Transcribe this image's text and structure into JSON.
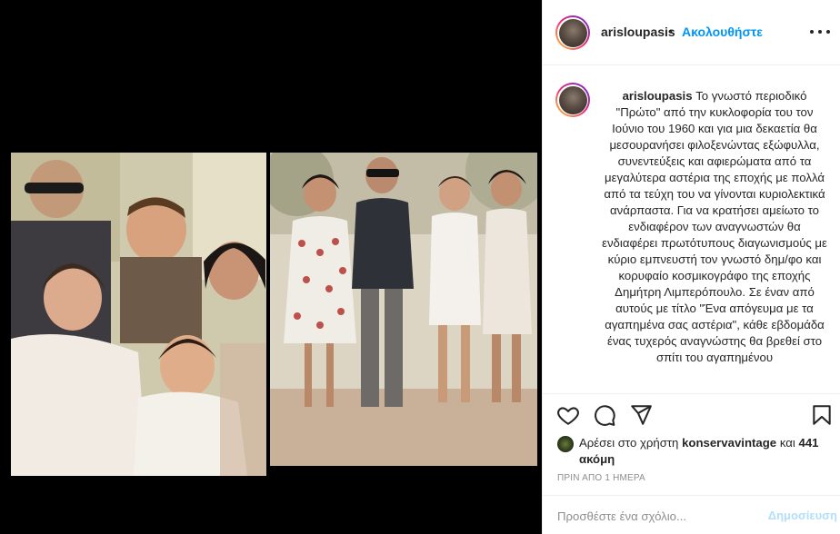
{
  "post": {
    "media": {
      "photos": [
        "vintage-family-photo",
        "vintage-garden-group-photo"
      ]
    },
    "header": {
      "username": "arisloupasis",
      "separator": "•",
      "follow_label": "Ακολουθήστε"
    },
    "caption": {
      "username": "arisloupasis",
      "text": "Το γνωστό περιοδικό \"Πρώτο\" από την κυκλοφορία του τον Ιούνιο του 1960 και για μια δεκαετία θα μεσουρανήσει φιλοξενώντας εξώφυλλα, συνεντεύξεις και αφιερώματα από τα μεγαλύτερα αστέρια της εποχής με πολλά από τα τεύχη του να γίνονται κυριολεκτικά ανάρπαστα. Για να κρατήσει αμείωτο το ενδιαφέρον των αναγνωστών θα ενδιαφέρει πρωτότυπους διαγωνισμούς με κύριο εμπνευστή τον γνωστό δημ/φο και κορυφαίο κοσμικογράφο της εποχής Δημήτρη Λιμπερόπουλο. Σε έναν από αυτούς με τίτλο \"Ένα απόγευμα με τα αγαπημένα σας αστέρια\", κάθε εβδομάδα ένας τυχερός αναγνώστης θα βρεθεί στο σπίτι του αγαπημένου"
    },
    "actions": {
      "like_icon": "heart-icon",
      "comment_icon": "comment-icon",
      "share_icon": "share-icon",
      "save_icon": "bookmark-icon"
    },
    "likes": {
      "prefix": "Αρέσει στο χρήστη ",
      "user": "konservavintage",
      "middle": " και ",
      "count": "441 ακόμη"
    },
    "timestamp": "ΠΡΙΝ ΑΠΟ 1 ΗΜΕΡΑ",
    "comment_box": {
      "placeholder": "Προσθέστε ένα σχόλιο...",
      "post_label": "Δημοσίευση"
    }
  },
  "colors": {
    "accent": "#0095f6",
    "post_disabled": "#b2dffc",
    "muted": "#8e8e8e",
    "text": "#262626"
  }
}
